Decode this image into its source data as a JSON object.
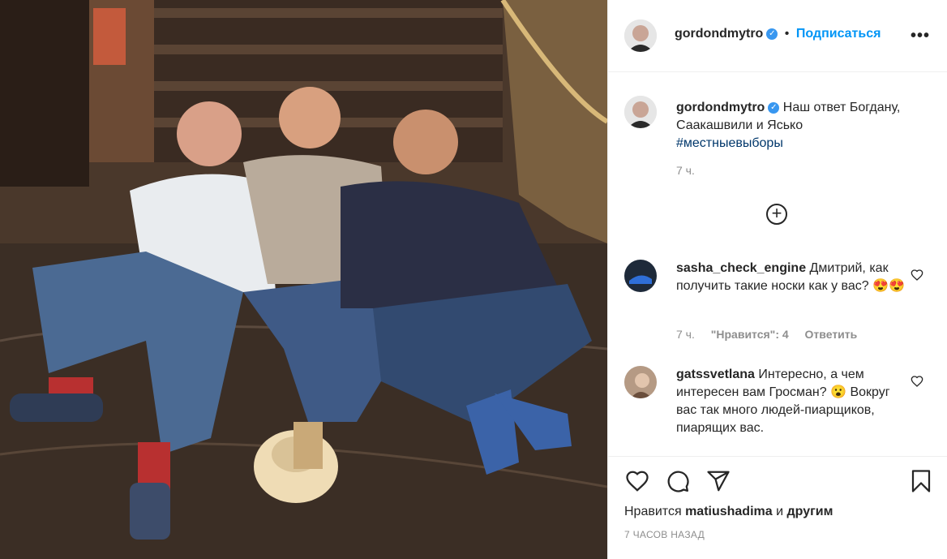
{
  "post": {
    "username": "gordondmytro",
    "follow_label": "Подписаться",
    "more_label": "•••",
    "caption_text": "Наш ответ Богдану, Саакашвили и Ясько",
    "caption_hashtag": "#местныевыборы",
    "caption_time": "7 ч.",
    "load_more_label": "+"
  },
  "comments": [
    {
      "username": "sasha_check_engine",
      "text": "Дмитрий, как получить такие носки как у вас? 😍😍",
      "time": "7 ч.",
      "likes": "\"Нравится\": 4",
      "reply": "Ответить"
    },
    {
      "username": "gatssvetlana",
      "text": "Интересно, а чем интересен вам Гросман? 😮 Вокруг вас так много людей-пиарщиков, пиарящих вас."
    }
  ],
  "footer": {
    "likes_prefix": "Нравится",
    "likes_user": "matiushadima",
    "likes_and": "и",
    "likes_others": "другим",
    "time_ago": "7 ЧАСОВ НАЗАД"
  },
  "icons": {
    "heart": "heart-icon",
    "comment": "comment-icon",
    "share": "share-icon",
    "bookmark": "bookmark-icon",
    "add": "plus-circle-icon",
    "verified": "verified-badge-icon"
  },
  "colors": {
    "link": "#0095f6",
    "verified": "#3897f0",
    "hashtag": "#00376b",
    "muted": "#8e8e8e"
  }
}
